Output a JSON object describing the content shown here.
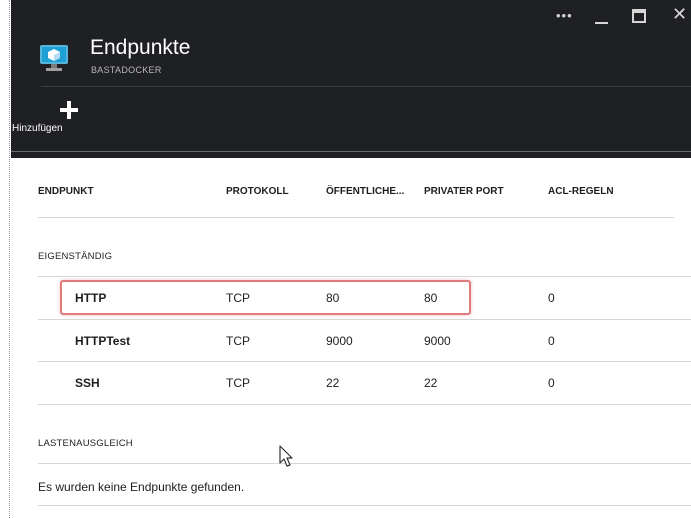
{
  "window": {
    "more_label": "•••",
    "close_label": "✕"
  },
  "blade": {
    "title": "Endpunkte",
    "subtitle": "BASTADOCKER",
    "icon": "virtual-machine-icon"
  },
  "commands": [
    {
      "label": "Hinzufügen",
      "icon": "plus-icon"
    }
  ],
  "table": {
    "columns": [
      "ENDPUNKT",
      "PROTOKOLL",
      "ÖFFENTLICHE...",
      "PRIVATER PORT",
      "ACL-REGELN"
    ],
    "groups": [
      {
        "label": "EIGENSTÄNDIG",
        "rows": [
          {
            "name": "HTTP",
            "protocol": "TCP",
            "public_port": "80",
            "private_port": "80",
            "acl": "0"
          },
          {
            "name": "HTTPTest",
            "protocol": "TCP",
            "public_port": "9000",
            "private_port": "9000",
            "acl": "0"
          },
          {
            "name": "SSH",
            "protocol": "TCP",
            "public_port": "22",
            "private_port": "22",
            "acl": "0"
          }
        ]
      },
      {
        "label": "LASTENAUSGLEICH",
        "empty_message": "Es wurden keine Endpunkte gefunden."
      }
    ]
  },
  "colors": {
    "header_bg": "#1f2023",
    "highlight": "#e07c7c",
    "accent_icon": "#1e9fd6"
  }
}
